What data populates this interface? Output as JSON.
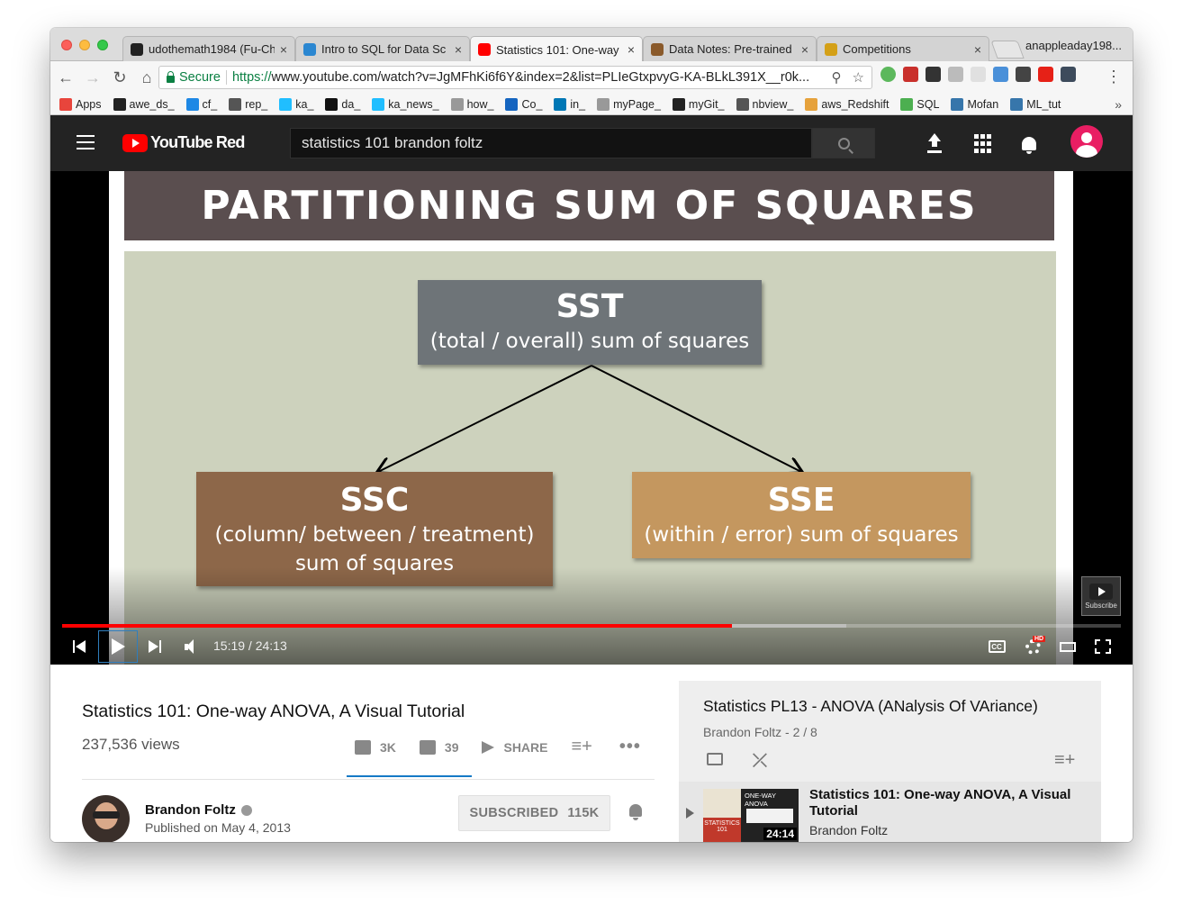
{
  "browser": {
    "tabs": [
      {
        "label": "udothemath1984 (Fu-Ch",
        "favicon": "github-icon",
        "color": "#222222"
      },
      {
        "label": "Intro to SQL for Data Sc",
        "favicon": "shield-icon",
        "color": "#2b87d1"
      },
      {
        "label": "Statistics 101: One-way",
        "favicon": "youtube-icon",
        "color": "#ff0000"
      },
      {
        "label": "Data Notes: Pre-trained",
        "favicon": "kaggle-icon",
        "color": "#8a5a2b"
      },
      {
        "label": "Competitions",
        "favicon": "doc-icon",
        "color": "#d4a017"
      }
    ],
    "close_glyph": "×",
    "profile": "anappleaday198...",
    "secure_label": "Secure",
    "url_scheme": "https://",
    "url_rest": "www.youtube.com/watch?v=JgMFhKi6f6Y&index=2&list=PLIeGtxpvyG-KA-BLkL391X__r0k...",
    "bookmarks": [
      {
        "label": "Apps",
        "color": "#e8453c"
      },
      {
        "label": "awe_ds_",
        "color": "#222222"
      },
      {
        "label": "cf_",
        "color": "#1e88e5"
      },
      {
        "label": "rep_",
        "color": "#555555"
      },
      {
        "label": "ka_",
        "color": "#20beff"
      },
      {
        "label": "da_",
        "color": "#111111"
      },
      {
        "label": "ka_news_",
        "color": "#20beff"
      },
      {
        "label": "how_",
        "color": "#999999"
      },
      {
        "label": "Co_",
        "color": "#1565c0"
      },
      {
        "label": "in_",
        "color": "#0077b5"
      },
      {
        "label": "myPage_",
        "color": "#999999"
      },
      {
        "label": "myGit_",
        "color": "#222222"
      },
      {
        "label": "nbview_",
        "color": "#555555"
      },
      {
        "label": "aws_Redshift",
        "color": "#e6a23c"
      },
      {
        "label": "SQL",
        "color": "#4caf50"
      },
      {
        "label": "Mofan",
        "color": "#3776ab"
      },
      {
        "label": "ML_tut",
        "color": "#3776ab"
      }
    ]
  },
  "youtube": {
    "logo_text": "YouTube Red",
    "search_value": "statistics 101 brandon foltz"
  },
  "slide": {
    "title": "PARTITIONING SUM OF SQUARES",
    "sst": {
      "big": "SST",
      "small": "(total / overall) sum of squares"
    },
    "ssc": {
      "big": "SSC",
      "line1": "(column/ between / treatment)",
      "line2": "sum of squares"
    },
    "sse": {
      "big": "SSE",
      "small": "(within / error) sum of squares"
    },
    "colors": {
      "title_bg": "#5a4e4f",
      "body_bg": "#cdd2bd",
      "sst": "#6e7478",
      "ssc": "#8d6749",
      "sse": "#c4975f"
    }
  },
  "player": {
    "time": "15:19 / 24:13",
    "played_fraction": 0.633,
    "buffered_fraction": 0.741,
    "subscribe_watermark": "Subscribe",
    "cc_label": "CC",
    "hd_badge": "HD"
  },
  "video": {
    "title": "Statistics 101: One-way ANOVA, A Visual Tutorial",
    "views": "237,536 views",
    "likes": "3K",
    "dislikes": "39",
    "share": "SHARE",
    "channel": "Brandon Foltz",
    "published": "Published on May 4, 2013",
    "subscribe_label": "SUBSCRIBED",
    "subscriber_count": "115K"
  },
  "playlist": {
    "title": "Statistics PL13 - ANOVA (ANalysis Of VAriance)",
    "subtitle": "Brandon Foltz - 2 / 8",
    "item": {
      "title": "Statistics 101: One-way ANOVA, A Visual Tutorial",
      "channel": "Brandon Foltz",
      "duration": "24:14",
      "thumb_top": "ONE-WAY ANOVA",
      "thumb_left": "STATISTICS 101"
    }
  }
}
